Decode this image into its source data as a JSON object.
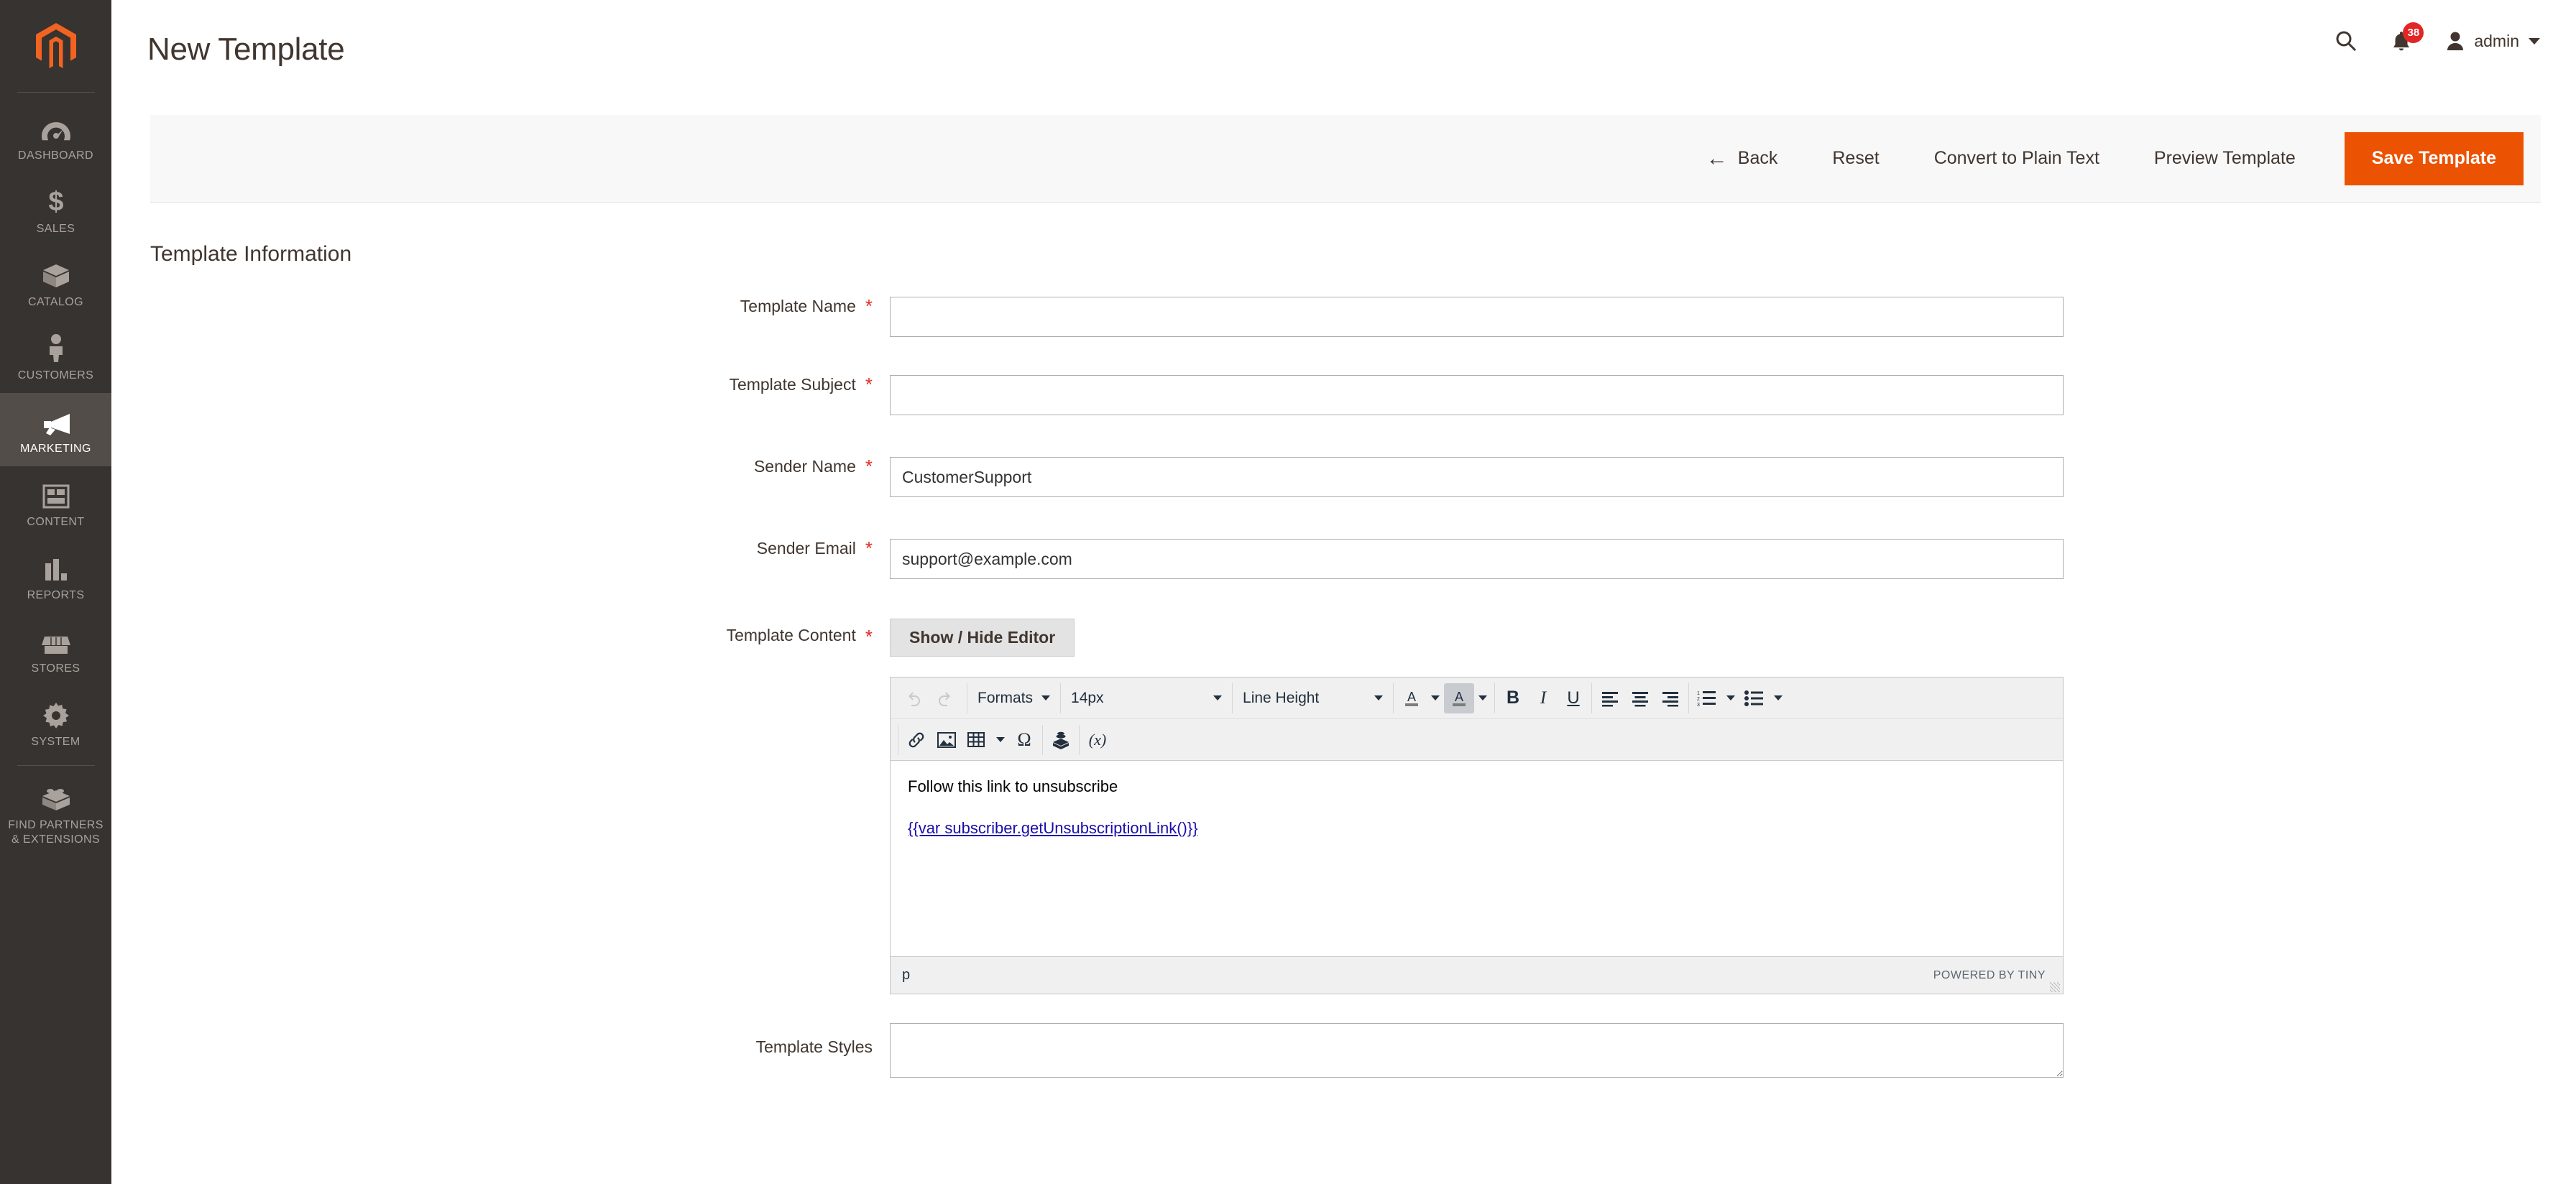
{
  "sidebar": {
    "logo": "magento-logo",
    "items": [
      {
        "label": "DASHBOARD",
        "icon": "dashboard-icon",
        "active": false
      },
      {
        "label": "SALES",
        "icon": "sales-dollar-icon",
        "active": false
      },
      {
        "label": "CATALOG",
        "icon": "catalog-box-icon",
        "active": false
      },
      {
        "label": "CUSTOMERS",
        "icon": "customers-person-icon",
        "active": false
      },
      {
        "label": "MARKETING",
        "icon": "marketing-megaphone-icon",
        "active": true
      },
      {
        "label": "CONTENT",
        "icon": "content-layout-icon",
        "active": false
      },
      {
        "label": "REPORTS",
        "icon": "reports-bar-chart-icon",
        "active": false
      },
      {
        "label": "STORES",
        "icon": "stores-storefront-icon",
        "active": false
      },
      {
        "label": "SYSTEM",
        "icon": "system-gear-icon",
        "active": false
      },
      {
        "label": "FIND PARTNERS\n& EXTENSIONS",
        "icon": "extensions-brick-icon",
        "active": false
      }
    ]
  },
  "header": {
    "title": "New Template",
    "search_icon": "search-icon",
    "notifications_icon": "bell-icon",
    "notifications_count": "38",
    "user_icon": "user-avatar-icon",
    "user_name": "admin"
  },
  "action_bar": {
    "back": "Back",
    "back_icon": "arrow-left-icon",
    "reset": "Reset",
    "convert": "Convert to Plain Text",
    "preview": "Preview Template",
    "save": "Save Template",
    "save_color": "#eb5202"
  },
  "form": {
    "section_title": "Template Information",
    "fields": [
      {
        "label": "Template Name",
        "required": true,
        "value": "",
        "placeholder": ""
      },
      {
        "label": "Template Subject",
        "required": true,
        "value": "",
        "placeholder": ""
      },
      {
        "label": "Sender Name",
        "required": true,
        "value": "CustomerSupport",
        "placeholder": ""
      },
      {
        "label": "Sender Email",
        "required": true,
        "value": "support@example.com",
        "placeholder": ""
      }
    ],
    "template_content": {
      "label": "Template Content",
      "required": true,
      "toggle_button": "Show / Hide Editor"
    },
    "template_styles": {
      "label": "Template Styles",
      "required": false,
      "value": "",
      "placeholder": ""
    }
  },
  "editor": {
    "toolbar_row1": {
      "undo_icon": "undo-icon",
      "redo_icon": "redo-icon",
      "formats_label": "Formats",
      "fontsize_label": "14px",
      "lineheight_label": "Line Height",
      "forecolor_icon": "text-color-icon",
      "backcolor_icon": "background-color-icon",
      "bold_label": "B",
      "italic_label": "I",
      "underline_label": "U",
      "align_left_icon": "align-left-icon",
      "align_center_icon": "align-center-icon",
      "align_right_icon": "align-right-icon",
      "numlist_icon": "numbered-list-icon",
      "bullist_icon": "bulleted-list-icon"
    },
    "toolbar_row2": {
      "link_icon": "link-icon",
      "image_icon": "image-icon",
      "table_icon": "table-icon",
      "charmap_icon": "special-character-omega-icon",
      "widget_icon": "magento-widget-icon",
      "variable_label": "(x)"
    },
    "content": {
      "paragraph": "Follow this link to unsubscribe",
      "link_text": "{{var subscriber.getUnsubscriptionLink()}}"
    },
    "status": {
      "element_path": "p",
      "brand": "POWERED BY TINY",
      "resize_handle": "resize-grip-icon"
    }
  }
}
